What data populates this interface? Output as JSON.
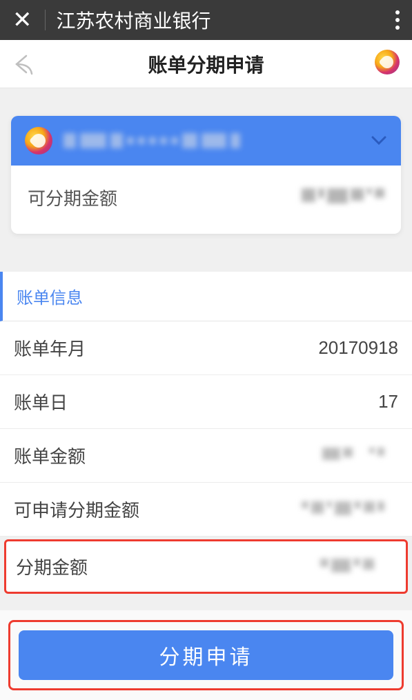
{
  "system": {
    "app_name": "江苏农村商业银行"
  },
  "header": {
    "title": "账单分期申请"
  },
  "card": {
    "account_masked": "**** **** **** ****",
    "installable_label": "可分期金额",
    "installable_amount": "****"
  },
  "section": {
    "title": "账单信息"
  },
  "rows": {
    "bill_yearmonth_label": "账单年月",
    "bill_yearmonth_value": "20170918",
    "bill_day_label": "账单日",
    "bill_day_value": "17",
    "bill_amount_label": "账单金额",
    "bill_amount_value": "****",
    "applicable_label": "可申请分期金额",
    "applicable_value": "****",
    "install_amount_label": "分期金额",
    "install_amount_value": "****"
  },
  "footer": {
    "apply_label": "分期申请"
  }
}
